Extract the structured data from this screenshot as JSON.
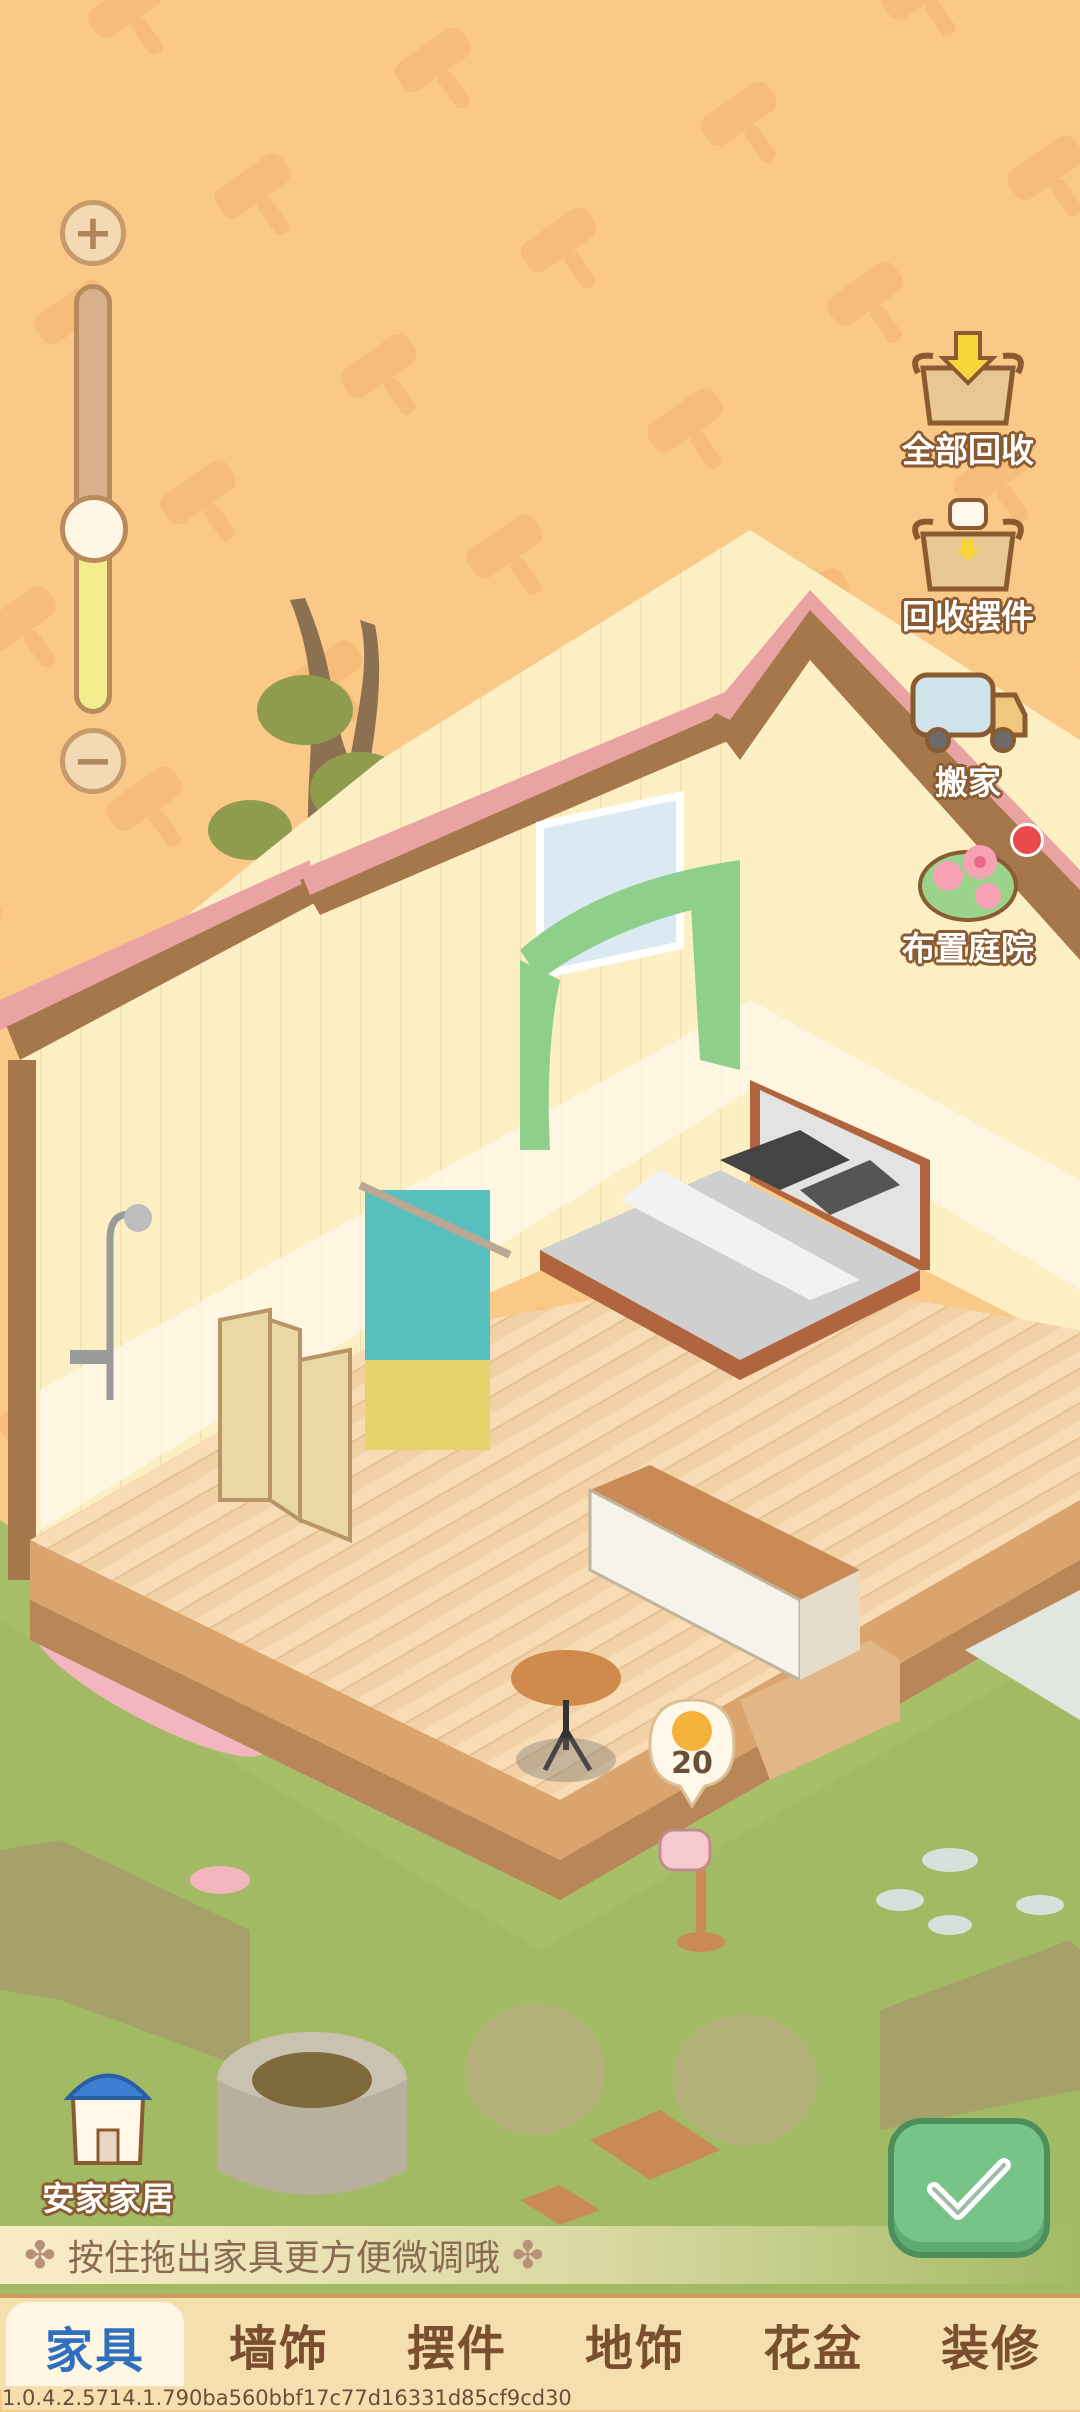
{
  "zoom": {
    "level": 0.43,
    "plus_icon": "plus-icon",
    "minus_icon": "minus-icon"
  },
  "tools": [
    {
      "label": "全部回收",
      "icon": "recycle-all-bag-icon"
    },
    {
      "label": "回收摆件",
      "icon": "recycle-decor-bag-icon"
    },
    {
      "label": "搬家",
      "icon": "moving-truck-icon"
    },
    {
      "label": "布置庭院",
      "icon": "garden-flowers-icon",
      "has_notification": true
    }
  ],
  "mailbox": {
    "count": "20",
    "icon": "cat-coin-icon"
  },
  "family": {
    "label": "安家家居",
    "icon": "furniture-shop-icon"
  },
  "hint": {
    "text": "按住拖出家具更方便微调哦"
  },
  "tabs": [
    {
      "label": "家具",
      "active": true
    },
    {
      "label": "墙饰",
      "active": false
    },
    {
      "label": "摆件",
      "active": false
    },
    {
      "label": "地饰",
      "active": false
    },
    {
      "label": "花盆",
      "active": false
    },
    {
      "label": "装修",
      "active": false
    }
  ],
  "version": "1.0.4.2.5714.1.790ba560bbf17c77d16331d85cf9cd30",
  "colors": {
    "background": "#fbc987",
    "confirm": "#77c489",
    "active_tab_text": "#2f6fbd",
    "tab_text": "#7a4f2f"
  }
}
